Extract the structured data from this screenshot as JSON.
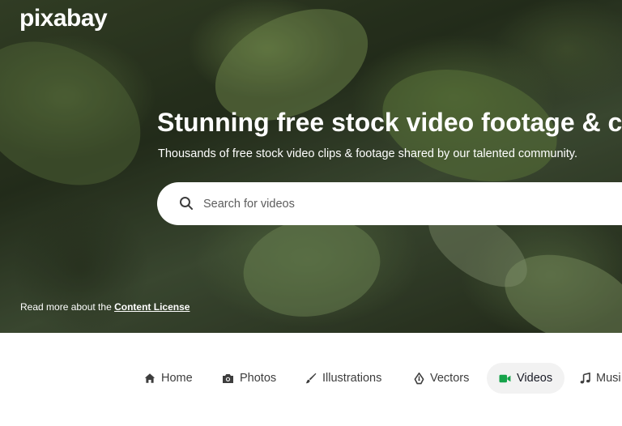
{
  "header": {
    "logo": "pixabay"
  },
  "hero": {
    "title": "Stunning free stock video footage & c",
    "subtitle": "Thousands of free stock video clips & footage shared by our talented community.",
    "search": {
      "placeholder": "Search for videos",
      "value": "",
      "icon": "search-icon"
    },
    "license_note": {
      "prefix": "Read more about the ",
      "link": "Content License"
    }
  },
  "nav": {
    "items": [
      {
        "label": "Home",
        "icon": "home-icon",
        "active": false
      },
      {
        "label": "Photos",
        "icon": "camera-icon",
        "active": false
      },
      {
        "label": "Illustrations",
        "icon": "brush-icon",
        "active": false
      },
      {
        "label": "Vectors",
        "icon": "pen-nib-icon",
        "active": false
      },
      {
        "label": "Videos",
        "icon": "video-camera-icon",
        "active": true
      },
      {
        "label": "Musi",
        "icon": "music-note-icon",
        "active": false
      }
    ]
  },
  "colors": {
    "active_icon": "#16a34a",
    "active_bg": "#f2f2f2",
    "text": "#3d3d3d"
  }
}
